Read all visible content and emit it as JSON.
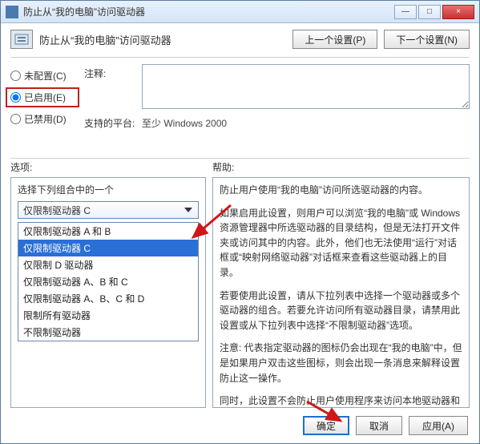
{
  "window": {
    "title": "防止从“我的电脑”访问驱动器",
    "min_label": "—",
    "max_label": "□",
    "close_label": "×"
  },
  "header": {
    "title": "防止从“我的电脑”访问驱动器",
    "prev": "上一个设置(P)",
    "next": "下一个设置(N)"
  },
  "radios": {
    "unconfigured": "未配置(C)",
    "enabled": "已启用(E)",
    "disabled": "已禁用(D)"
  },
  "form": {
    "comment_label": "注释:",
    "platform_label": "支持的平台:",
    "platform_value": "至少 Windows 2000"
  },
  "section_labels": {
    "options": "选项:",
    "help": "帮助:"
  },
  "options": {
    "caption": "选择下列组合中的一个",
    "selected_combo": "仅限制驱动器 C",
    "items": [
      "仅限制驱动器 A 和 B",
      "仅限制驱动器 C",
      "仅限制 D 驱动器",
      "仅限制驱动器 A、B 和 C",
      "仅限制驱动器 A、B、C 和 D",
      "限制所有驱动器",
      "不限制驱动器"
    ]
  },
  "help": {
    "p1": "防止用户使用“我的电脑”访问所选驱动器的内容。",
    "p2": "如果启用此设置，则用户可以浏览“我的电脑”或 Windows 资源管理器中所选驱动器的目录结构，但是无法打开文件夹或访问其中的内容。此外，他们也无法使用“运行”对话框或“映射网络驱动器”对话框来查看这些驱动器上的目录。",
    "p3": "若要使用此设置，请从下拉列表中选择一个驱动器或多个驱动器的组合。若要允许访问所有驱动器目录，请禁用此设置或从下拉列表中选择“不限制驱动器”选项。",
    "p4": "注意: 代表指定驱动器的图标仍会出现在“我的电脑”中，但是如果用户双击这些图标，则会出现一条消息来解释设置防止这一操作。",
    "p5": "同时，此设置不会防止用户使用程序来访问本地驱动器和网络驱动器，也不会防止他们使用“磁盘管理”管理单元查看并更改驱动器特性。"
  },
  "footer": {
    "ok": "确定",
    "cancel": "取消",
    "apply": "应用(A)"
  }
}
